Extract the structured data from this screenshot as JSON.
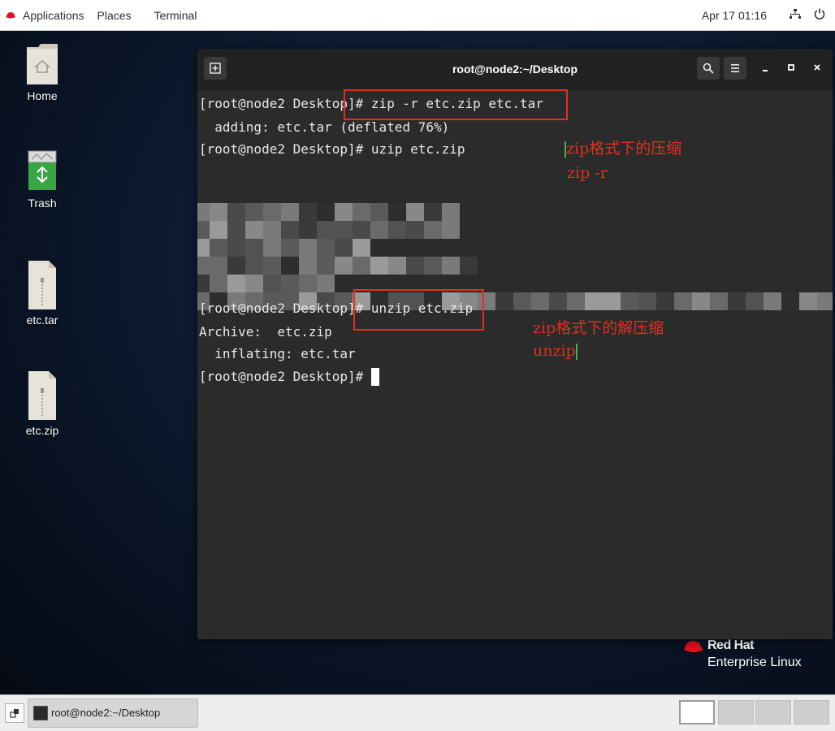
{
  "topbar": {
    "applications": "Applications",
    "places": "Places",
    "terminal": "Terminal",
    "clock": "Apr 17  01:16",
    "network_icon": "network-icon",
    "power_icon": "power-icon"
  },
  "desktop_icons": [
    {
      "label": "Home",
      "icon": "home-folder-icon"
    },
    {
      "label": "Trash",
      "icon": "trash-icon"
    },
    {
      "label": "etc.tar",
      "icon": "archive-file-icon"
    },
    {
      "label": "etc.zip",
      "icon": "archive-file-icon"
    }
  ],
  "terminal": {
    "title": "root@node2:~/Desktop",
    "lines": [
      "[root@node2 Desktop]# zip -r etc.zip etc.tar",
      "  adding: etc.tar (deflated 76%)",
      "[root@node2 Desktop]# uzip etc.zip",
      "[root@node2 Desktop]# unzip etc.zip",
      "Archive:  etc.zip",
      "  inflating: etc.tar",
      "[root@node2 Desktop]# "
    ],
    "annotations": {
      "zip_title": "zip格式下的压缩",
      "zip_cmd": "zip -r",
      "unzip_title": "zip格式下的解压缩",
      "unzip_cmd": "unzip"
    },
    "colors": {
      "background": "#2b2b2b",
      "annotation": "#e0301e"
    }
  },
  "branding": {
    "line1": "Red Hat",
    "line2": "Enterprise Linux"
  },
  "taskbar": {
    "window_label": "root@node2:~/Desktop",
    "workspaces": 4,
    "active_workspace": 1
  }
}
